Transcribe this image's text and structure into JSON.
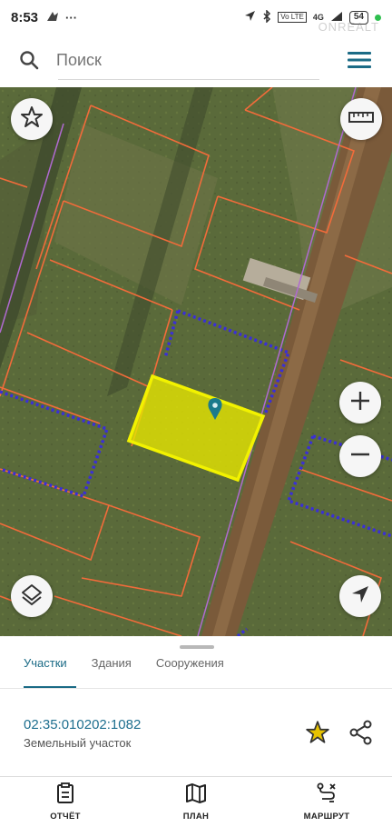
{
  "status_bar": {
    "time": "8:53",
    "network_label": "4G",
    "volte_label": "Vo LTE",
    "battery": "54",
    "watermark": "ONREALT"
  },
  "search": {
    "placeholder": "Поиск"
  },
  "map": {
    "selected_parcel_color": "#e8e800",
    "parcel_border_color": "#f26b3a",
    "zone_border_color": "#3a2fd6",
    "pin_color": "#1b7a8c"
  },
  "sheet": {
    "tabs": [
      "Участки",
      "Здания",
      "Сооружения"
    ],
    "active_tab": "Участки",
    "parcel_number": "02:35:010202:1082",
    "parcel_type": "Земельный участок"
  },
  "bottom_nav": {
    "items": [
      {
        "label": "ОТЧЁТ",
        "icon": "report-icon"
      },
      {
        "label": "ПЛАН",
        "icon": "map-icon"
      },
      {
        "label": "МАРШРУТ",
        "icon": "route-icon"
      }
    ]
  },
  "colors": {
    "accent": "#1b6b86",
    "star": "#e6c200"
  }
}
